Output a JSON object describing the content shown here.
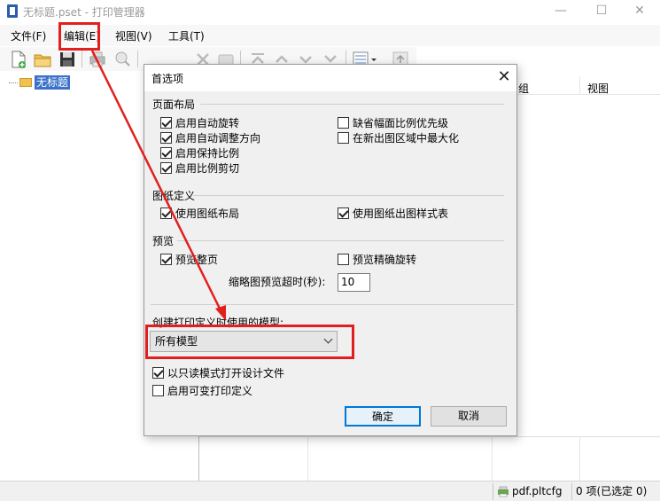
{
  "window": {
    "title": "无标题.pset - 打印管理器",
    "minimize_glyph": "—",
    "maximize_glyph": "☐",
    "close_glyph": "✕"
  },
  "menu": {
    "file": "文件(F)",
    "edit": "编辑(E)",
    "view": "视图(V)",
    "tools": "工具(T)"
  },
  "tree": {
    "root_label": "无标题"
  },
  "list": {
    "columns": [
      "组",
      "视图"
    ]
  },
  "status": {
    "config": "pdf.pltcfg",
    "selection": "0 项(已选定 0)"
  },
  "dialog": {
    "title": "首选项",
    "close_glyph": "✕",
    "page_layout": {
      "label": "页面布局",
      "options": [
        {
          "label": "启用自动旋转",
          "checked": true
        },
        {
          "label": "启用自动调整方向",
          "checked": true
        },
        {
          "label": "启用保持比例",
          "checked": true
        },
        {
          "label": "启用比例剪切",
          "checked": true
        },
        {
          "label": "缺省幅面比例优先级",
          "checked": false
        },
        {
          "label": "在新出图区域中最大化",
          "checked": false
        }
      ]
    },
    "sheet_definition": {
      "label": "图纸定义",
      "options": [
        {
          "label": "使用图纸布局",
          "checked": true
        },
        {
          "label": "使用图纸出图样式表",
          "checked": true
        }
      ]
    },
    "preview": {
      "label": "预览",
      "options": [
        {
          "label": "预览整页",
          "checked": true
        },
        {
          "label": "预览精确旋转",
          "checked": false
        }
      ],
      "timeout_label": "缩略图预览超时(秒):",
      "timeout_value": "10"
    },
    "model": {
      "label": "创建打印定义时使用的模型:",
      "selected": "所有模型"
    },
    "misc_options": [
      {
        "label": "以只读模式打开设计文件",
        "checked": true
      },
      {
        "label": "启用可变打印定义",
        "checked": false
      }
    ],
    "ok_label": "确定",
    "cancel_label": "取消"
  },
  "colors": {
    "highlight_red": "#e21f1f",
    "selection_blue": "#3a71c9",
    "primary_button_border": "#0078d7"
  },
  "icons": [
    "new-file-icon",
    "open-folder-icon",
    "save-icon",
    "print-icon",
    "preview-icon",
    "delete-icon",
    "move-top-icon",
    "move-up-icon",
    "move-down-icon",
    "move-bottom-icon",
    "view-list-icon",
    "up-level-icon",
    "folder-icon",
    "printer-status-icon"
  ]
}
